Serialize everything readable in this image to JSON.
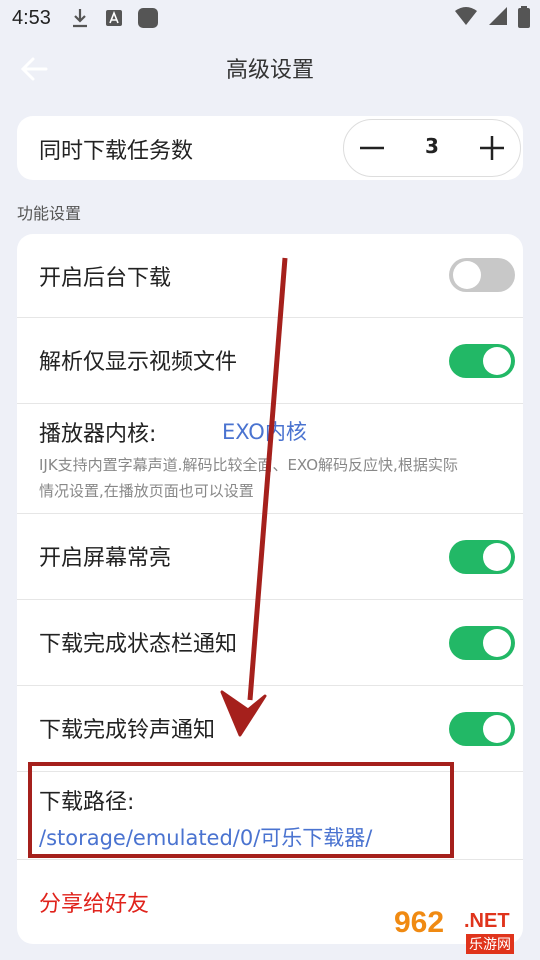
{
  "status_bar": {
    "time": "4:53"
  },
  "header": {
    "title": "高级设置"
  },
  "concurrent": {
    "label": "同时下载任务数",
    "value": "3"
  },
  "section": {
    "label": "功能设置"
  },
  "settings": {
    "background_download": {
      "label": "开启后台下载",
      "on": false
    },
    "video_only": {
      "label": "解析仅显示视频文件",
      "on": true
    },
    "player_core": {
      "label": "播放器内核:",
      "value": "EXO内核",
      "desc": "IJK支持内置字幕声道.解码比较全面、EXO解码反应快,根据实际情况设置,在播放页面也可以设置"
    },
    "screen_on": {
      "label": "开启屏幕常亮",
      "on": true
    },
    "status_notify": {
      "label": "下载完成状态栏通知",
      "on": true
    },
    "ring_notify": {
      "label": "下载完成铃声通知",
      "on": true
    },
    "download_path": {
      "label": "下载路径:",
      "value": "/storage/emulated/0/可乐下载器/"
    },
    "share": {
      "label": "分享给好友"
    }
  },
  "watermark": {
    "number": "962",
    "suffix": ".NET",
    "site": "乐游网"
  },
  "colors": {
    "accent": "#22b866",
    "link": "#4a73d0",
    "danger": "#e0231c",
    "annotation": "#a5201c"
  }
}
